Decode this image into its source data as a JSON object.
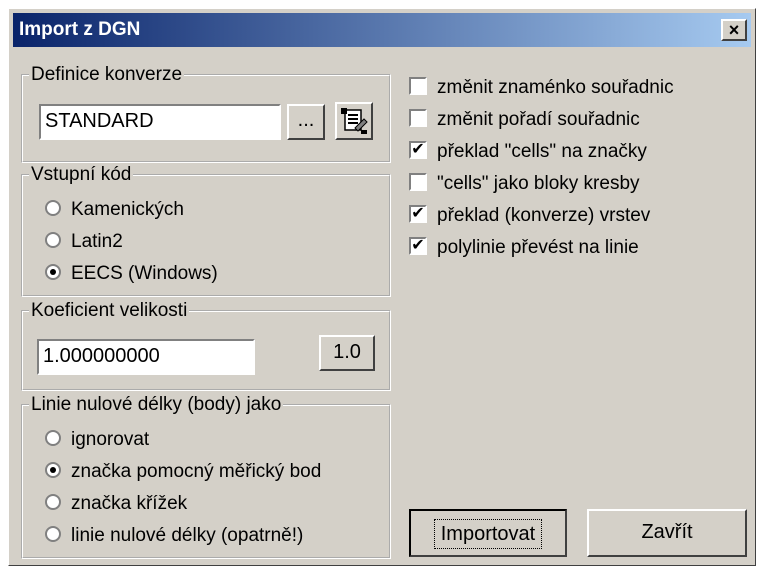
{
  "window": {
    "title": "Import z DGN",
    "close_label": "×"
  },
  "conversion": {
    "legend": "Definice konverze",
    "value": "STANDARD",
    "browse_label": "...",
    "edit_icon": "edit-definition-icon"
  },
  "input_code": {
    "legend": "Vstupní kód",
    "options": [
      {
        "label": "Kamenických",
        "selected": false
      },
      {
        "label": "Latin2",
        "selected": false
      },
      {
        "label": "EECS (Windows)",
        "selected": true
      }
    ]
  },
  "size_coefficient": {
    "legend": "Koeficient velikosti",
    "value": "1.000000000",
    "reset_label": "1.0"
  },
  "zero_length": {
    "legend": "Linie nulové délky (body) jako",
    "options": [
      {
        "label": "ignorovat",
        "selected": false
      },
      {
        "label": "značka pomocný měřický bod",
        "selected": true
      },
      {
        "label": "značka křížek",
        "selected": false
      },
      {
        "label": "linie nulové délky (opatrně!)",
        "selected": false
      }
    ]
  },
  "options": [
    {
      "label": "změnit znaménko souřadnic",
      "checked": false
    },
    {
      "label": "změnit pořadí souřadnic",
      "checked": false
    },
    {
      "label": "překlad \"cells\" na značky",
      "checked": true
    },
    {
      "label": "\"cells\" jako bloky kresby",
      "checked": false
    },
    {
      "label": "překlad (konverze) vrstev",
      "checked": true
    },
    {
      "label": "polylinie převést na linie",
      "checked": true
    }
  ],
  "buttons": {
    "import_label": "Importovat",
    "close_label": "Zavřít"
  }
}
